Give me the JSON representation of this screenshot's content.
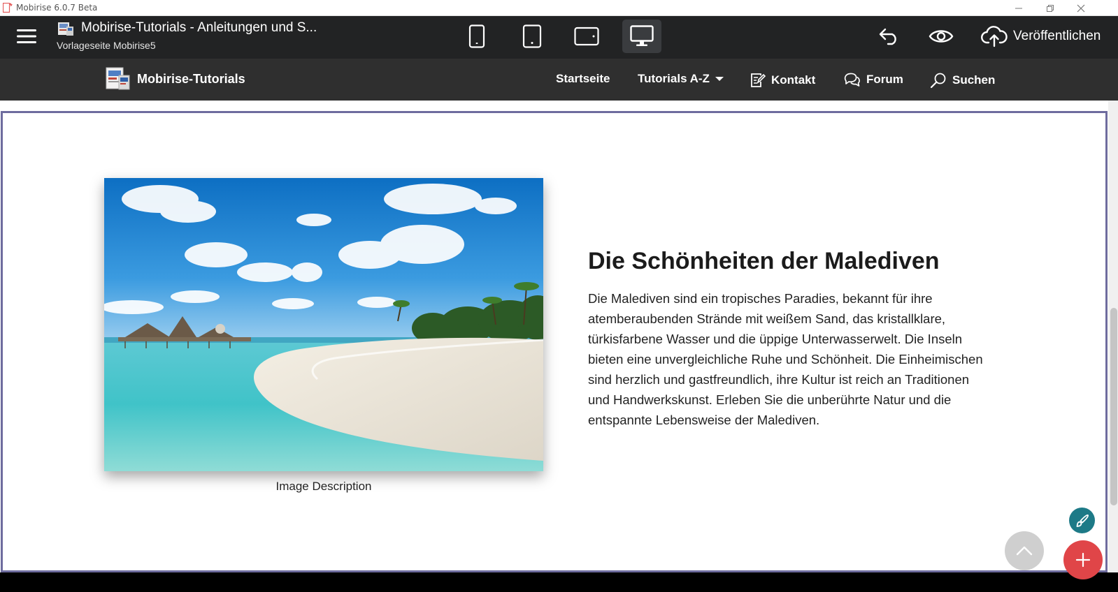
{
  "window": {
    "title": "Mobirise 6.0.7 Beta"
  },
  "editor": {
    "page_title": "Mobirise-Tutorials - Anleitungen und S...",
    "page_subtitle": "Vorlageseite Mobirise5",
    "devices": [
      "mobile",
      "tablet",
      "tablet-landscape",
      "desktop"
    ],
    "active_device": "desktop",
    "publish_label": "Veröffentlichen"
  },
  "site_nav": {
    "brand": "Mobirise-Tutorials",
    "items": [
      {
        "label": "Startseite",
        "icon": ""
      },
      {
        "label": "Tutorials A-Z",
        "icon": "caret-down-icon"
      },
      {
        "label": "Kontakt",
        "icon": "edit-note-icon"
      },
      {
        "label": "Forum",
        "icon": "chat-bubbles-icon"
      },
      {
        "label": "Suchen",
        "icon": "search-icon"
      }
    ]
  },
  "content": {
    "image_caption": "Image Description",
    "heading": "Die Schönheiten der Malediven",
    "body": "Die Malediven sind ein tropisches Paradies, bekannt für ihre atemberaubenden Strände mit weißem Sand, das kristallklare, türkisfarbene Wasser und die üppige Unterwasserwelt. Die Inseln bieten eine unvergleichliche Ruhe und Schönheit. Die Einheimischen sind herzlich und gastfreundlich, ihre Kultur ist reich an Traditionen und Handwerkskunst. Erleben Sie die unberührte Natur und die entspannte Lebensweise der Malediven."
  },
  "colors": {
    "toolbar": "#222324",
    "site_nav": "#2f2f2f",
    "section_border": "#6e6c9e",
    "fab_add": "#e04548",
    "fab_edit": "#1d7a87"
  }
}
